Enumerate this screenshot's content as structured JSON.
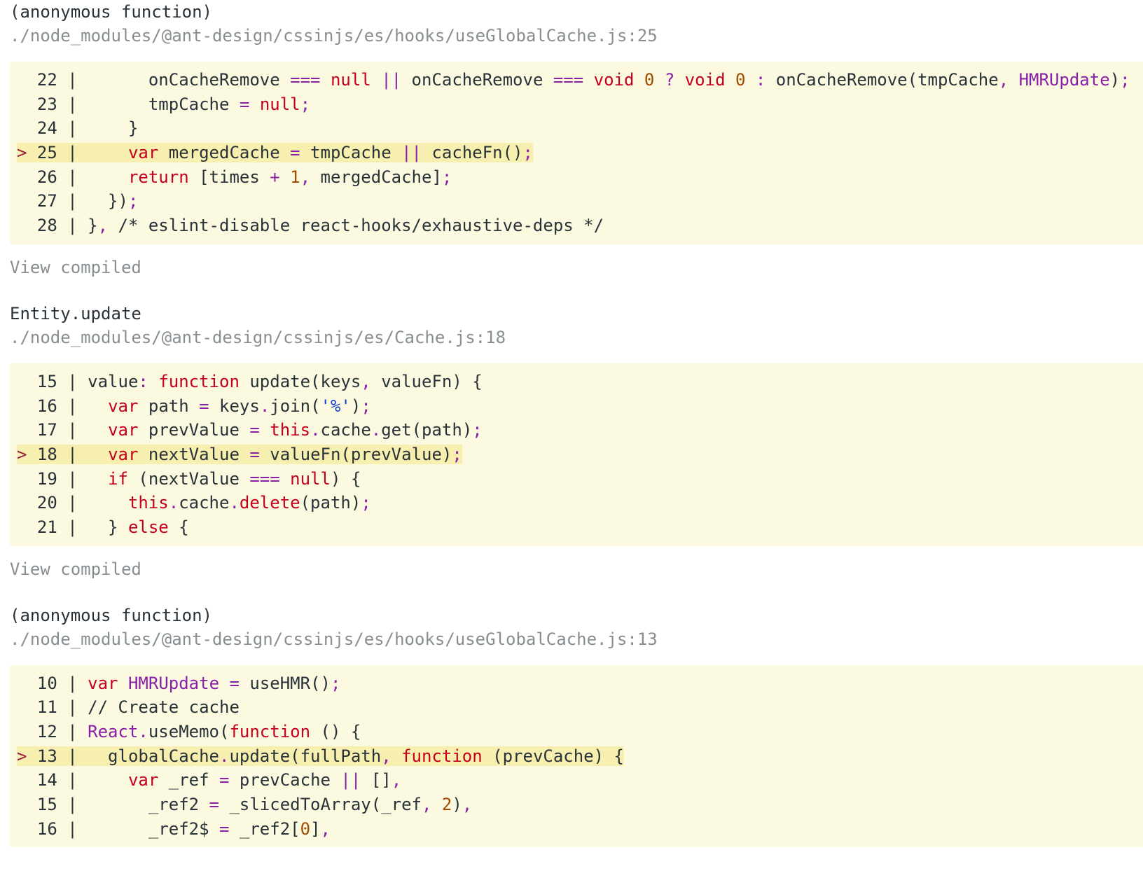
{
  "frames": [
    {
      "function_name": "(anonymous function)",
      "file_path": "./node_modules/@ant-design/cssinjs/es/hooks/useGlobalCache.js:25",
      "view_compiled": "View compiled",
      "lines": [
        {
          "gutter": "  22 | ",
          "highlight": false,
          "tokens": [
            [
              "pl",
              "      onCacheRemove "
            ],
            [
              "op",
              "==="
            ],
            [
              "pl",
              " "
            ],
            [
              "kw",
              "null"
            ],
            [
              "pl",
              " "
            ],
            [
              "op",
              "||"
            ],
            [
              "pl",
              " onCacheRemove "
            ],
            [
              "op",
              "==="
            ],
            [
              "pl",
              " "
            ],
            [
              "kw",
              "void"
            ],
            [
              "pl",
              " "
            ],
            [
              "num",
              "0"
            ],
            [
              "pl",
              " "
            ],
            [
              "op",
              "?"
            ],
            [
              "pl",
              " "
            ],
            [
              "kw",
              "void"
            ],
            [
              "pl",
              " "
            ],
            [
              "num",
              "0"
            ],
            [
              "pl",
              " "
            ],
            [
              "op",
              ":"
            ],
            [
              "pl",
              " onCacheRemove(tmpCache"
            ],
            [
              "op",
              ","
            ],
            [
              "pl",
              " "
            ],
            [
              "obj",
              "HMRUpdate"
            ],
            [
              "pl",
              ")"
            ],
            [
              "op",
              ";"
            ]
          ]
        },
        {
          "gutter": "  23 | ",
          "highlight": false,
          "tokens": [
            [
              "pl",
              "      tmpCache "
            ],
            [
              "op",
              "="
            ],
            [
              "pl",
              " "
            ],
            [
              "kw",
              "null"
            ],
            [
              "op",
              ";"
            ]
          ]
        },
        {
          "gutter": "  24 | ",
          "highlight": false,
          "tokens": [
            [
              "pl",
              "    }"
            ]
          ]
        },
        {
          "gutter": "> 25 | ",
          "highlight": true,
          "tokens": [
            [
              "pl",
              "    "
            ],
            [
              "kw",
              "var"
            ],
            [
              "pl",
              " mergedCache "
            ],
            [
              "op",
              "="
            ],
            [
              "pl",
              " tmpCache "
            ],
            [
              "op",
              "||"
            ],
            [
              "pl",
              " cacheFn()"
            ],
            [
              "op",
              ";"
            ]
          ]
        },
        {
          "gutter": "  26 | ",
          "highlight": false,
          "tokens": [
            [
              "pl",
              "    "
            ],
            [
              "kw",
              "return"
            ],
            [
              "pl",
              " [times "
            ],
            [
              "op",
              "+"
            ],
            [
              "pl",
              " "
            ],
            [
              "num",
              "1"
            ],
            [
              "op",
              ","
            ],
            [
              "pl",
              " mergedCache]"
            ],
            [
              "op",
              ";"
            ]
          ]
        },
        {
          "gutter": "  27 | ",
          "highlight": false,
          "tokens": [
            [
              "pl",
              "  })"
            ],
            [
              "op",
              ";"
            ]
          ]
        },
        {
          "gutter": "  28 | ",
          "highlight": false,
          "tokens": [
            [
              "pl",
              "}"
            ],
            [
              "op",
              ","
            ],
            [
              "pl",
              " /* eslint-disable react-hooks/exhaustive-deps */"
            ]
          ]
        }
      ]
    },
    {
      "function_name": "Entity.update",
      "file_path": "./node_modules/@ant-design/cssinjs/es/Cache.js:18",
      "view_compiled": "View compiled",
      "lines": [
        {
          "gutter": "  15 | ",
          "highlight": false,
          "tokens": [
            [
              "pl",
              "value"
            ],
            [
              "op",
              ":"
            ],
            [
              "pl",
              " "
            ],
            [
              "kw",
              "function"
            ],
            [
              "pl",
              " update(keys"
            ],
            [
              "op",
              ","
            ],
            [
              "pl",
              " valueFn) {"
            ]
          ]
        },
        {
          "gutter": "  16 | ",
          "highlight": false,
          "tokens": [
            [
              "pl",
              "  "
            ],
            [
              "kw",
              "var"
            ],
            [
              "pl",
              " path "
            ],
            [
              "op",
              "="
            ],
            [
              "pl",
              " keys"
            ],
            [
              "op",
              "."
            ],
            [
              "pl",
              "join("
            ],
            [
              "str",
              "'%'"
            ],
            [
              "pl",
              ")"
            ],
            [
              "op",
              ";"
            ]
          ]
        },
        {
          "gutter": "  17 | ",
          "highlight": false,
          "tokens": [
            [
              "pl",
              "  "
            ],
            [
              "kw",
              "var"
            ],
            [
              "pl",
              " prevValue "
            ],
            [
              "op",
              "="
            ],
            [
              "pl",
              " "
            ],
            [
              "kw",
              "this"
            ],
            [
              "op",
              "."
            ],
            [
              "pl",
              "cache"
            ],
            [
              "op",
              "."
            ],
            [
              "pl",
              "get(path)"
            ],
            [
              "op",
              ";"
            ]
          ]
        },
        {
          "gutter": "> 18 | ",
          "highlight": true,
          "tokens": [
            [
              "pl",
              "  "
            ],
            [
              "kw",
              "var"
            ],
            [
              "pl",
              " nextValue "
            ],
            [
              "op",
              "="
            ],
            [
              "pl",
              " valueFn(prevValue)"
            ],
            [
              "op",
              ";"
            ]
          ]
        },
        {
          "gutter": "  19 | ",
          "highlight": false,
          "tokens": [
            [
              "pl",
              "  "
            ],
            [
              "kw",
              "if"
            ],
            [
              "pl",
              " (nextValue "
            ],
            [
              "op",
              "==="
            ],
            [
              "pl",
              " "
            ],
            [
              "kw",
              "null"
            ],
            [
              "pl",
              ") {"
            ]
          ]
        },
        {
          "gutter": "  20 | ",
          "highlight": false,
          "tokens": [
            [
              "pl",
              "    "
            ],
            [
              "kw",
              "this"
            ],
            [
              "op",
              "."
            ],
            [
              "pl",
              "cache"
            ],
            [
              "op",
              "."
            ],
            [
              "kw",
              "delete"
            ],
            [
              "pl",
              "(path)"
            ],
            [
              "op",
              ";"
            ]
          ]
        },
        {
          "gutter": "  21 | ",
          "highlight": false,
          "tokens": [
            [
              "pl",
              "  } "
            ],
            [
              "kw",
              "else"
            ],
            [
              "pl",
              " {"
            ]
          ]
        }
      ]
    },
    {
      "function_name": "(anonymous function)",
      "file_path": "./node_modules/@ant-design/cssinjs/es/hooks/useGlobalCache.js:13",
      "view_compiled": "",
      "lines": [
        {
          "gutter": "  10 | ",
          "highlight": false,
          "tokens": [
            [
              "kw",
              "var"
            ],
            [
              "pl",
              " "
            ],
            [
              "obj",
              "HMRUpdate"
            ],
            [
              "pl",
              " "
            ],
            [
              "op",
              "="
            ],
            [
              "pl",
              " useHMR()"
            ],
            [
              "op",
              ";"
            ]
          ]
        },
        {
          "gutter": "  11 | ",
          "highlight": false,
          "tokens": [
            [
              "pl",
              "// Create cache"
            ]
          ]
        },
        {
          "gutter": "  12 | ",
          "highlight": false,
          "tokens": [
            [
              "obj",
              "React"
            ],
            [
              "op",
              "."
            ],
            [
              "pl",
              "useMemo("
            ],
            [
              "kw",
              "function"
            ],
            [
              "pl",
              " () {"
            ]
          ]
        },
        {
          "gutter": "> 13 | ",
          "highlight": true,
          "tokens": [
            [
              "pl",
              "  globalCache"
            ],
            [
              "op",
              "."
            ],
            [
              "pl",
              "update(fullPath"
            ],
            [
              "op",
              ","
            ],
            [
              "pl",
              " "
            ],
            [
              "kw",
              "function"
            ],
            [
              "pl",
              " (prevCache) {"
            ]
          ]
        },
        {
          "gutter": "  14 | ",
          "highlight": false,
          "tokens": [
            [
              "pl",
              "    "
            ],
            [
              "kw",
              "var"
            ],
            [
              "pl",
              " _ref "
            ],
            [
              "op",
              "="
            ],
            [
              "pl",
              " prevCache "
            ],
            [
              "op",
              "||"
            ],
            [
              "pl",
              " []"
            ],
            [
              "op",
              ","
            ]
          ]
        },
        {
          "gutter": "  15 | ",
          "highlight": false,
          "tokens": [
            [
              "pl",
              "      _ref2 "
            ],
            [
              "op",
              "="
            ],
            [
              "pl",
              " _slicedToArray(_ref"
            ],
            [
              "op",
              ","
            ],
            [
              "pl",
              " "
            ],
            [
              "num",
              "2"
            ],
            [
              "pl",
              ")"
            ],
            [
              "op",
              ","
            ]
          ]
        },
        {
          "gutter": "  16 | ",
          "highlight": false,
          "tokens": [
            [
              "pl",
              "      _ref2$ "
            ],
            [
              "op",
              "="
            ],
            [
              "pl",
              " _ref2["
            ],
            [
              "num",
              "0"
            ],
            [
              "pl",
              "]"
            ],
            [
              "op",
              ","
            ]
          ]
        }
      ]
    }
  ]
}
